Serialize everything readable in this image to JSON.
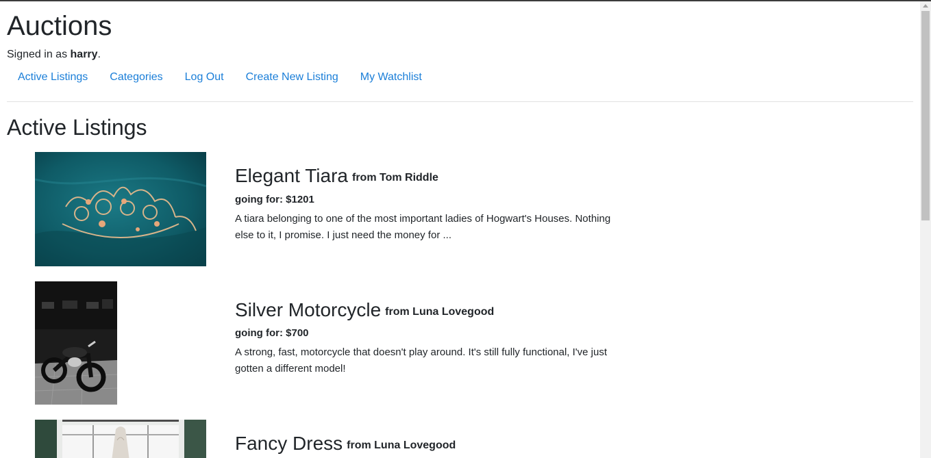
{
  "header": {
    "site_title": "Auctions",
    "signed_in_prefix": "Signed in as",
    "username": "harry",
    "signed_in_suffix": "."
  },
  "nav": [
    {
      "label": "Active Listings"
    },
    {
      "label": "Categories"
    },
    {
      "label": "Log Out"
    },
    {
      "label": "Create New Listing"
    },
    {
      "label": "My Watchlist"
    }
  ],
  "main": {
    "heading": "Active Listings",
    "price_prefix": "going for:",
    "listings": [
      {
        "title": "Elegant Tiara",
        "seller": "from Tom Riddle",
        "price": "$1201",
        "description": "A tiara belonging to one of the most important ladies of Hogwart's Houses. Nothing else to it, I promise. I just need the money for ..."
      },
      {
        "title": "Silver Motorcycle",
        "seller": "from Luna Lovegood",
        "price": "$700",
        "description": "A strong, fast, motorcycle that doesn't play around. It's still fully functional, I've just gotten a different model!"
      },
      {
        "title": "Fancy Dress",
        "seller": "from Luna Lovegood"
      }
    ]
  },
  "colors": {
    "link": "#1a7ed8",
    "text": "#212529",
    "tiara_background": "#0e5a65"
  }
}
